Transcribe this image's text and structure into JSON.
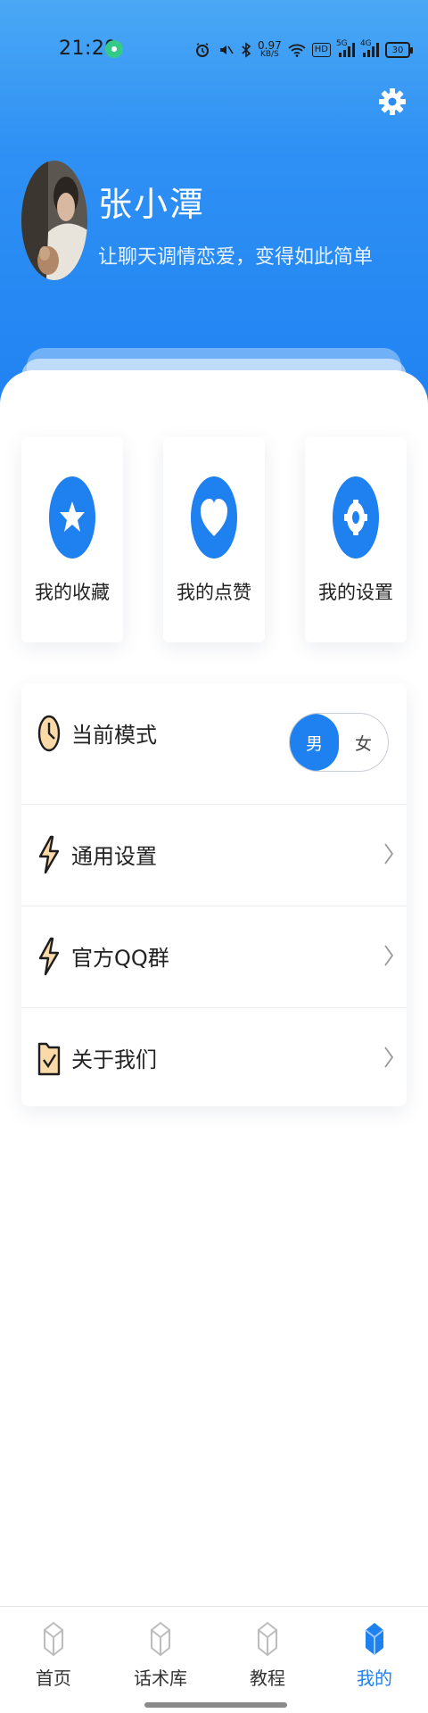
{
  "status_bar": {
    "time": "21:29",
    "net_speed_value": "0.97",
    "net_speed_unit": "KB/S",
    "hd": "HD",
    "signal_1_tag": "5G",
    "signal_2_tag": "4G",
    "battery": "30"
  },
  "profile": {
    "name": "张小潭",
    "tagline": "让聊天调情恋爱，变得如此简单"
  },
  "quick_actions": [
    {
      "label": "我的收藏",
      "icon": "star-icon"
    },
    {
      "label": "我的点赞",
      "icon": "heart-icon"
    },
    {
      "label": "我的设置",
      "icon": "gear-icon"
    }
  ],
  "menu": {
    "mode": {
      "label": "当前模式",
      "options": [
        "男",
        "女"
      ],
      "selected": "男"
    },
    "items": [
      {
        "label": "通用设置",
        "icon": "bolt-icon"
      },
      {
        "label": "官方QQ群",
        "icon": "bolt-icon"
      },
      {
        "label": "关于我们",
        "icon": "folder-check-icon"
      }
    ]
  },
  "tabbar": {
    "tabs": [
      {
        "label": "首页",
        "active": false
      },
      {
        "label": "话术库",
        "active": false
      },
      {
        "label": "教程",
        "active": false
      },
      {
        "label": "我的",
        "active": true
      }
    ]
  },
  "colors": {
    "accent": "#1f80f0",
    "hero_top": "#4aa8f5",
    "hero_bottom": "#1f82f2"
  }
}
